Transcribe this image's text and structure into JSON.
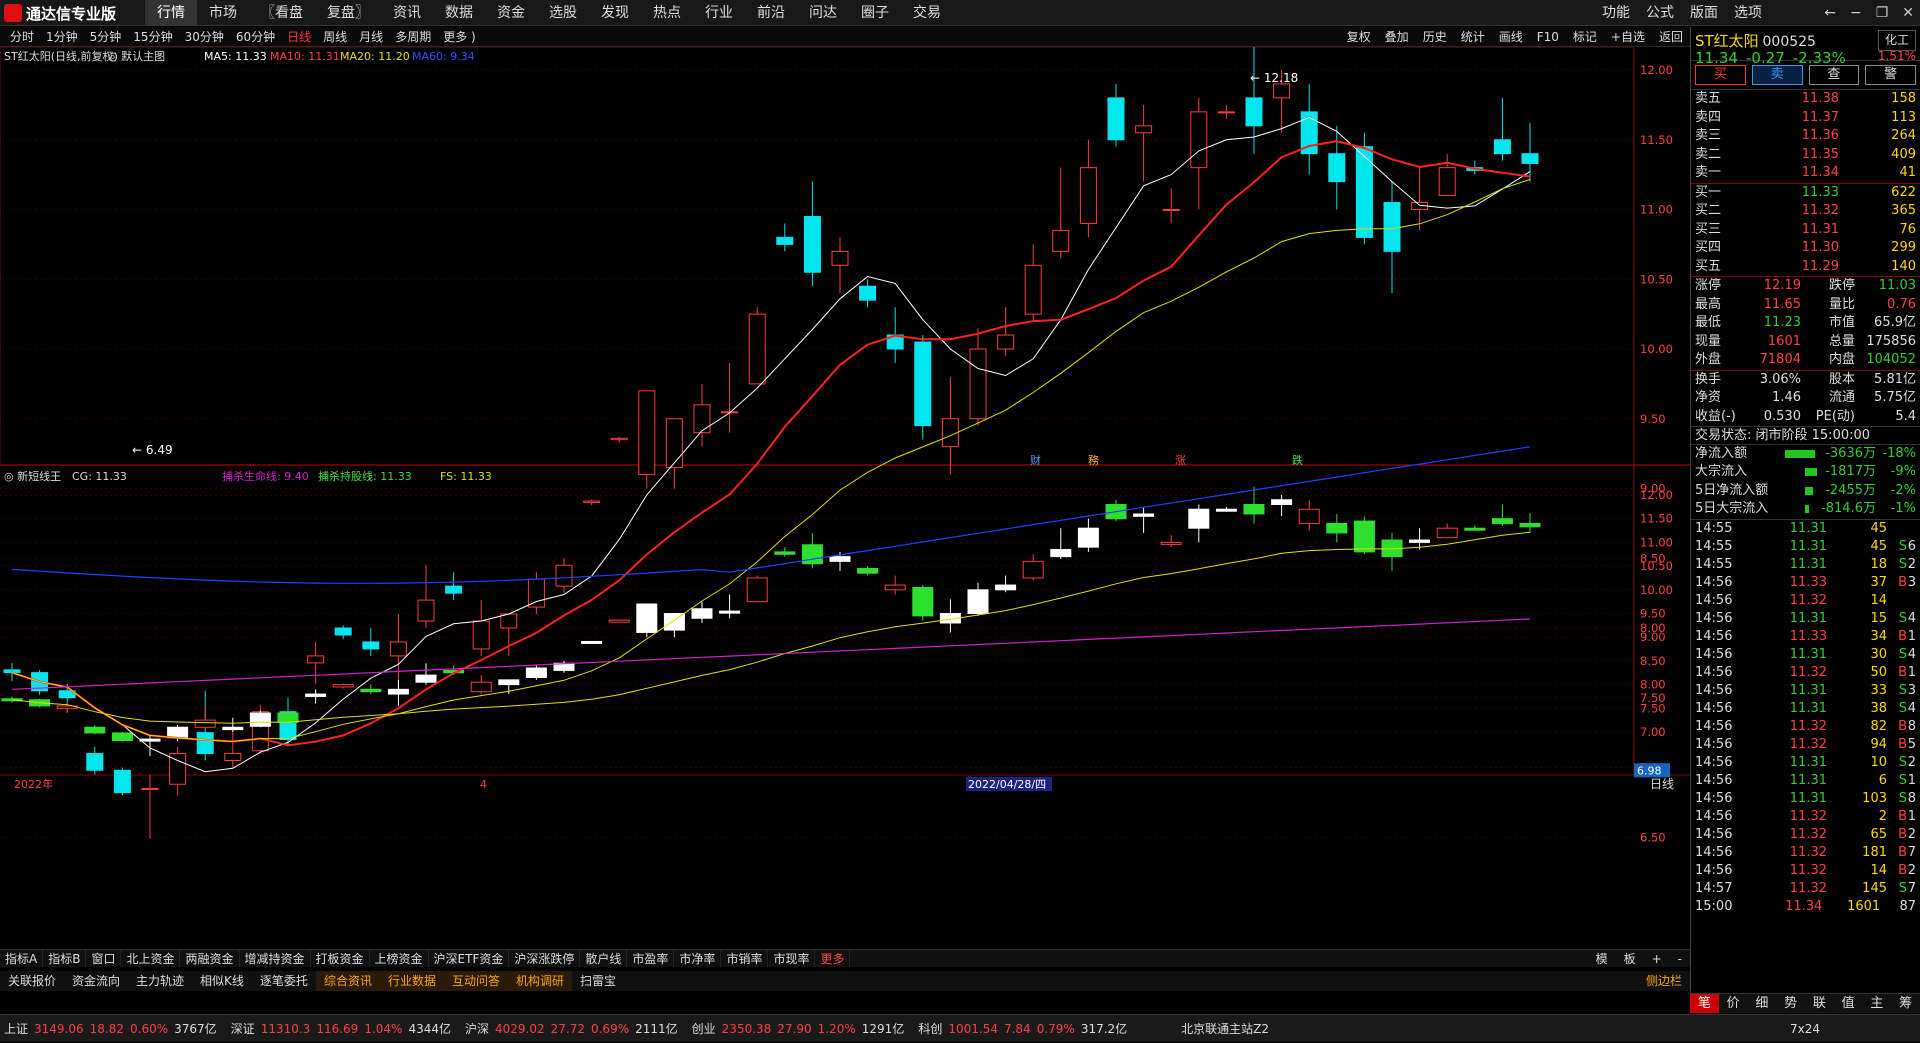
{
  "app": {
    "title": "通达信专业版"
  },
  "menu": [
    "行情",
    "市场",
    "〖看盘",
    "复盘〗",
    "资讯",
    "数据",
    "资金",
    "选股",
    "发现",
    "热点",
    "行业",
    "前沿",
    "问达",
    "圈子",
    "交易"
  ],
  "menu_right": [
    "功能",
    "公式",
    "版面",
    "选项"
  ],
  "periods": [
    "分时",
    "1分钟",
    "5分钟",
    "15分钟",
    "30分钟",
    "60分钟",
    "日线",
    "周线",
    "月线",
    "多周期",
    "更多 )"
  ],
  "active_period": "日线",
  "tools": [
    "复权",
    "叠加",
    "历史",
    "统计",
    "画线",
    "F10",
    "标记",
    "+自选",
    "返回"
  ],
  "main_legend": {
    "name": "ST红太阳(日线,前复权)",
    "tpl": "◎ 默认主图",
    "ma5": "MA5: 11.33",
    "ma10": "MA10: 11.31",
    "ma20": "MA20: 11.20",
    "ma60": "MA60: 9.34"
  },
  "sub_legend": {
    "name": "新短线王",
    "cg": "CG: 11.33",
    "l1": "捕杀生命线: 9.40",
    "l2": "捕杀持股线: 11.33",
    "fs": "FS: 11.33"
  },
  "price_axis_main": [
    "12.00",
    "11.50",
    "11.00",
    "10.50",
    "10.00",
    "9.50",
    "9.00",
    "8.50",
    "8.00",
    "7.50",
    "7.00",
    "6.50"
  ],
  "price_axis_sub": [
    "12.00",
    "11.50",
    "11.00",
    "10.50",
    "10.00",
    "9.50",
    "9.00",
    "8.50",
    "8.00",
    "7.50",
    "7.00"
  ],
  "cur_price_tag": "6.98",
  "hi_label": "12.18",
  "lo_label": "6.49",
  "events": [
    "财",
    "務",
    "涨",
    "跌"
  ],
  "date_left": "2022年",
  "date_mid_marker": "4",
  "date_cursor": "2022/04/28/四",
  "period_tag": "日线",
  "chart_data": {
    "type": "candlestick",
    "series": [
      {
        "name": "MA5",
        "values": [
          11.33
        ]
      },
      {
        "name": "MA10",
        "values": [
          11.31
        ]
      },
      {
        "name": "MA20",
        "values": [
          11.2
        ]
      },
      {
        "name": "MA60",
        "values": [
          9.34
        ]
      }
    ],
    "ohlc": [
      [
        7.7,
        7.75,
        7.62,
        7.68
      ],
      [
        7.68,
        7.7,
        7.52,
        7.55
      ],
      [
        7.55,
        7.6,
        7.4,
        7.5
      ],
      [
        7.1,
        7.15,
        6.95,
        6.98
      ],
      [
        6.98,
        7.0,
        6.8,
        6.82
      ],
      [
        6.85,
        6.95,
        6.49,
        6.85
      ],
      [
        6.88,
        7.15,
        6.8,
        7.1
      ],
      [
        7.25,
        7.55,
        7.05,
        7.1
      ],
      [
        7.05,
        7.3,
        7.0,
        7.1
      ],
      [
        7.12,
        7.45,
        7.1,
        7.4
      ],
      [
        7.4,
        7.5,
        7.15,
        7.2
      ],
      [
        7.75,
        7.9,
        7.6,
        7.8
      ],
      [
        8.0,
        8.02,
        7.92,
        7.95
      ],
      [
        7.9,
        8.0,
        7.8,
        7.85
      ],
      [
        7.8,
        8.1,
        7.55,
        7.9
      ],
      [
        8.05,
        8.45,
        8.0,
        8.2
      ],
      [
        8.3,
        8.4,
        8.2,
        8.25
      ],
      [
        7.85,
        8.2,
        7.8,
        8.05
      ],
      [
        8.0,
        8.1,
        7.8,
        8.1
      ],
      [
        8.15,
        8.4,
        8.1,
        8.35
      ],
      [
        8.3,
        8.5,
        8.25,
        8.45
      ],
      [
        8.9,
        8.92,
        8.88,
        8.91
      ],
      [
        9.35,
        9.37,
        9.33,
        9.36
      ],
      [
        9.1,
        9.7,
        9.0,
        9.7
      ],
      [
        9.15,
        9.5,
        9.0,
        9.5
      ],
      [
        9.4,
        9.75,
        9.3,
        9.6
      ],
      [
        9.55,
        9.9,
        9.4,
        9.55
      ],
      [
        9.75,
        10.3,
        9.75,
        10.25
      ],
      [
        10.8,
        10.9,
        10.7,
        10.75
      ],
      [
        10.95,
        11.2,
        10.45,
        10.55
      ],
      [
        10.6,
        10.8,
        10.4,
        10.7
      ],
      [
        10.45,
        10.5,
        10.3,
        10.35
      ],
      [
        10.1,
        10.3,
        9.9,
        10.0
      ],
      [
        10.05,
        10.1,
        9.35,
        9.45
      ],
      [
        9.3,
        9.8,
        9.1,
        9.5
      ],
      [
        9.5,
        10.15,
        9.45,
        10.0
      ],
      [
        10.0,
        10.3,
        9.95,
        10.1
      ],
      [
        10.25,
        10.75,
        10.2,
        10.6
      ],
      [
        10.7,
        11.3,
        10.65,
        10.85
      ],
      [
        10.9,
        11.5,
        10.8,
        11.3
      ],
      [
        11.8,
        11.9,
        11.45,
        11.5
      ],
      [
        11.55,
        11.75,
        11.2,
        11.6
      ],
      [
        11.0,
        11.15,
        10.9,
        11.0
      ],
      [
        11.3,
        11.8,
        11.0,
        11.7
      ],
      [
        11.7,
        11.75,
        11.65,
        11.7
      ],
      [
        11.8,
        12.18,
        11.4,
        11.6
      ],
      [
        11.8,
        12.0,
        11.55,
        11.9
      ],
      [
        11.7,
        11.9,
        11.25,
        11.4
      ],
      [
        11.4,
        11.6,
        11.0,
        11.2
      ],
      [
        11.45,
        11.55,
        10.75,
        10.8
      ],
      [
        11.05,
        11.2,
        10.4,
        10.7
      ],
      [
        11.0,
        11.3,
        10.85,
        11.05
      ],
      [
        11.1,
        11.4,
        11.1,
        11.3
      ],
      [
        11.3,
        11.35,
        11.25,
        11.28
      ],
      [
        11.5,
        11.8,
        11.35,
        11.4
      ],
      [
        11.4,
        11.62,
        11.2,
        11.33
      ]
    ]
  },
  "quote": {
    "name": "ST红太阳",
    "code": "000525",
    "sector": "化工",
    "price": "11.34",
    "chg": "-0.27",
    "pct": "-2.33%",
    "weibi": "1.51%",
    "trade_btns": [
      "买",
      "卖",
      "查",
      "警"
    ],
    "asks": [
      [
        "卖五",
        "11.38",
        "158"
      ],
      [
        "卖四",
        "11.37",
        "113"
      ],
      [
        "卖三",
        "11.36",
        "264"
      ],
      [
        "卖二",
        "11.35",
        "409"
      ],
      [
        "卖一",
        "11.34",
        "41"
      ]
    ],
    "bids": [
      [
        "买一",
        "11.33",
        "622"
      ],
      [
        "买二",
        "11.32",
        "365"
      ],
      [
        "买三",
        "11.31",
        "76"
      ],
      [
        "买四",
        "11.30",
        "299"
      ],
      [
        "买五",
        "11.29",
        "140"
      ]
    ],
    "stats": [
      [
        "涨停",
        "12.19",
        "跌停",
        "11.03"
      ],
      [
        "最高",
        "11.65",
        "量比",
        "0.76"
      ],
      [
        "最低",
        "11.23",
        "市值",
        "65.9亿"
      ],
      [
        "现量",
        "1601",
        "总量",
        "175856"
      ],
      [
        "外盘",
        "71804",
        "内盘",
        "104052"
      ]
    ],
    "stats2": [
      [
        "换手",
        "3.06%",
        "股本",
        "5.81亿"
      ],
      [
        "净资",
        "1.46",
        "流通",
        "5.75亿"
      ],
      [
        "收益(-)",
        "0.530",
        "PE(动)",
        "5.4"
      ]
    ],
    "trade_state": "交易状态: 闭市阶段 15:00:00",
    "flows": [
      [
        "净流入额",
        "-3636万",
        "-18%"
      ],
      [
        "大宗流入",
        "-1817万",
        "-9%"
      ],
      [
        "5日净流入额",
        "-2455万",
        "-2%"
      ],
      [
        "5日大宗流入",
        "-814.6万",
        "-1%"
      ]
    ],
    "ticks": [
      [
        "14:55",
        "11.31",
        "45",
        "",
        ""
      ],
      [
        "14:55",
        "11.31",
        "45",
        "S",
        "6"
      ],
      [
        "14:55",
        "11.31",
        "18",
        "S",
        "2"
      ],
      [
        "14:56",
        "11.33",
        "37",
        "B",
        "3"
      ],
      [
        "14:56",
        "11.32",
        "14",
        "",
        ""
      ],
      [
        "14:56",
        "11.31",
        "15",
        "S",
        "4"
      ],
      [
        "14:56",
        "11.33",
        "34",
        "B",
        "1"
      ],
      [
        "14:56",
        "11.31",
        "30",
        "S",
        "4"
      ],
      [
        "14:56",
        "11.32",
        "50",
        "B",
        "1"
      ],
      [
        "14:56",
        "11.31",
        "33",
        "S",
        "3"
      ],
      [
        "14:56",
        "11.31",
        "38",
        "S",
        "4"
      ],
      [
        "14:56",
        "11.32",
        "82",
        "B",
        "8"
      ],
      [
        "14:56",
        "11.32",
        "94",
        "B",
        "5"
      ],
      [
        "14:56",
        "11.31",
        "10",
        "S",
        "2"
      ],
      [
        "14:56",
        "11.31",
        "6",
        "S",
        "1"
      ],
      [
        "14:56",
        "11.31",
        "103",
        "S",
        "8"
      ],
      [
        "14:56",
        "11.32",
        "2",
        "B",
        "1"
      ],
      [
        "14:56",
        "11.32",
        "65",
        "B",
        "2"
      ],
      [
        "14:56",
        "11.32",
        "181",
        "B",
        "7"
      ],
      [
        "14:56",
        "11.32",
        "14",
        "B",
        "2"
      ],
      [
        "14:57",
        "11.32",
        "145",
        "S",
        "7"
      ],
      [
        "15:00",
        "11.34",
        "1601",
        "",
        "87"
      ]
    ],
    "side_tabs": [
      "笔",
      "价",
      "细",
      "势",
      "联",
      "值",
      "主",
      "筹"
    ]
  },
  "bottom_tabs": [
    "指标A",
    "指标B",
    "窗口",
    "北上资金",
    "两融资金",
    "增减持资金",
    "打板资金",
    "上榜资金",
    "沪深ETF资金",
    "沪深涨跌停",
    "散户线",
    "市盈率",
    "市净率",
    "市销率",
    "市现率",
    "更多"
  ],
  "bottom_right": [
    "模",
    "板",
    "+",
    "-"
  ],
  "bottom_tabs2": [
    "关联报价",
    "资金流向",
    "主力轨迹",
    "相似K线",
    "逐笔委托",
    "综合资讯",
    "行业数据",
    "互动问答",
    "机构调研",
    "扫雷宝"
  ],
  "bottom_tabs2_right": "侧边栏",
  "status": {
    "sh": [
      "上证",
      "3149.06",
      "18.82",
      "0.60%",
      "3767亿"
    ],
    "sz": [
      "深证",
      "11310.3",
      "116.69",
      "1.04%",
      "4344亿"
    ],
    "hs": [
      "沪深",
      "4029.02",
      "27.72",
      "0.69%",
      "2111亿"
    ],
    "cy": [
      "创业",
      "2350.38",
      "27.90",
      "1.20%",
      "1291亿"
    ],
    "kc": [
      "科创",
      "1001.54",
      "7.84",
      "0.79%",
      "317.2亿"
    ],
    "server": "北京联通主站Z2",
    "clock": "7x24"
  },
  "colors": {
    "up": "#ff4040",
    "down": "#00e5ee",
    "ma5": "#ffffff",
    "ma10": "#ff2020",
    "ma20": "#e0e000",
    "ma60": "#2040ff"
  }
}
